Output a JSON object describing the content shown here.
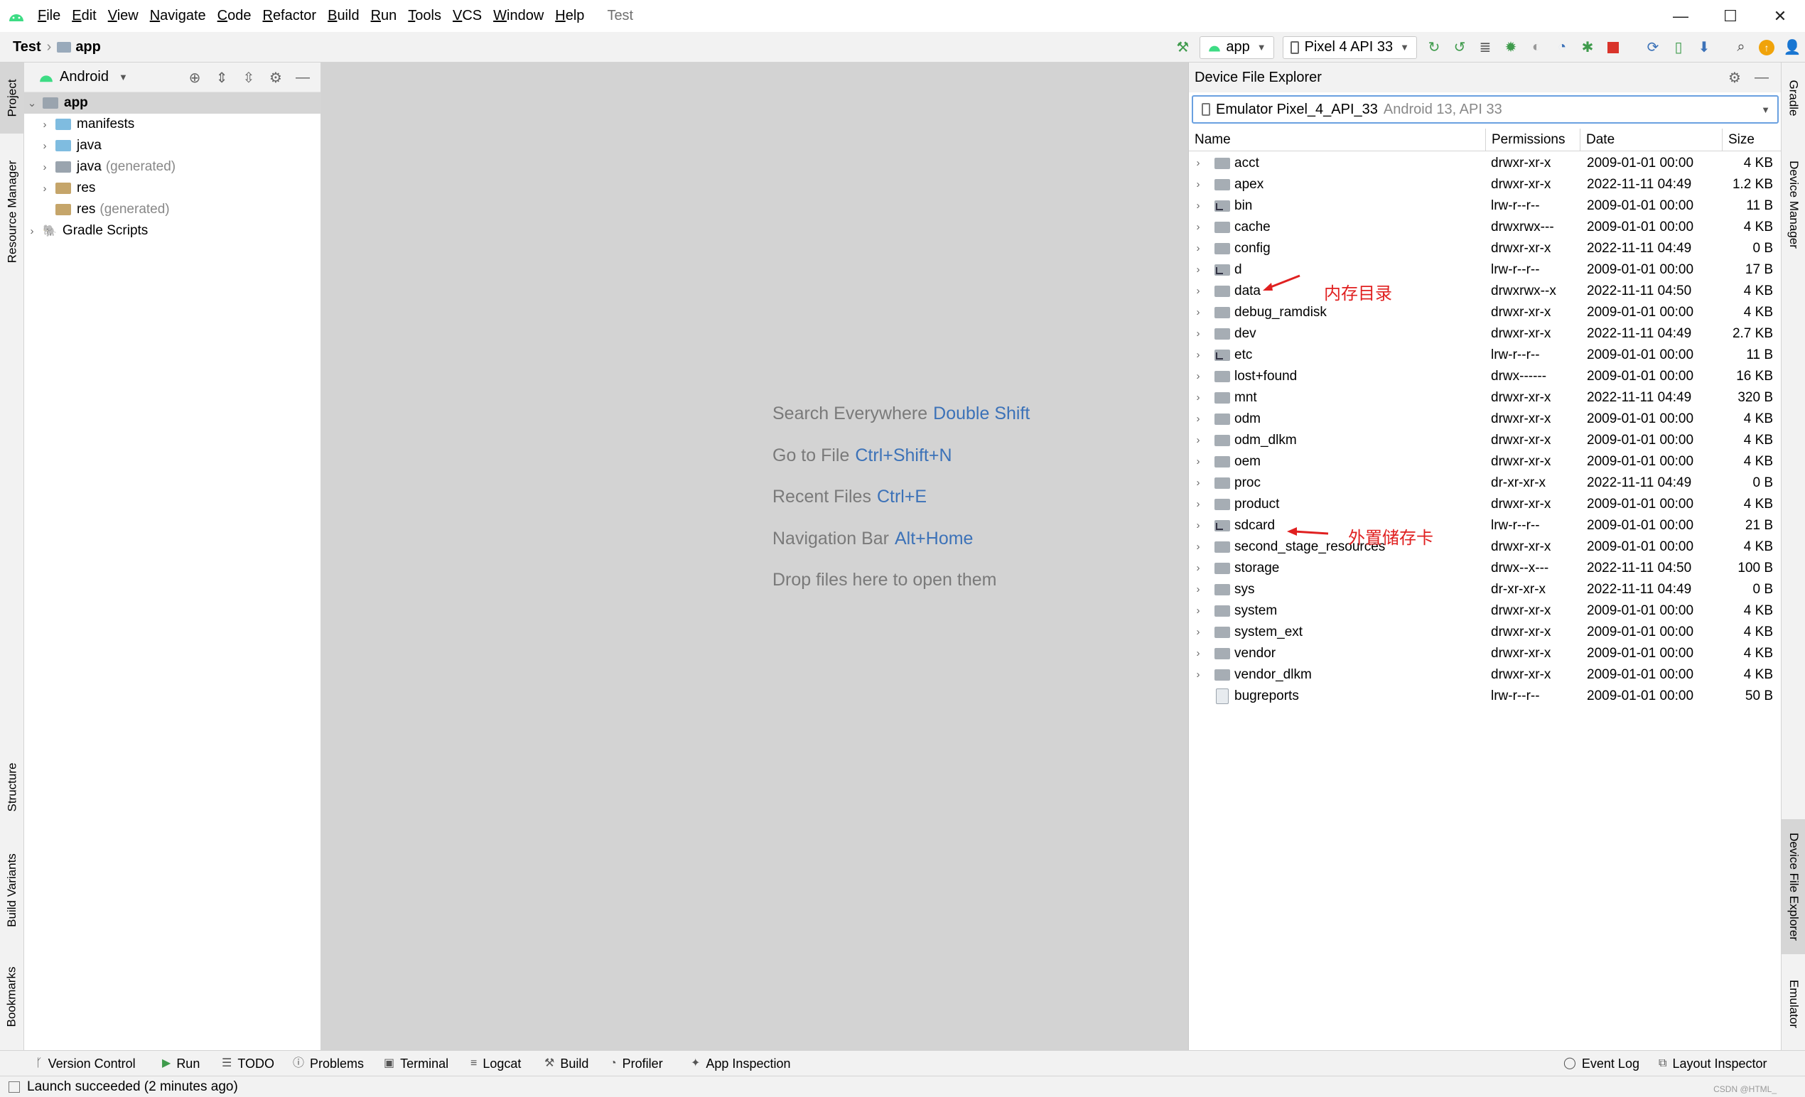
{
  "window": {
    "title": "Test",
    "menu": [
      {
        "u": "F",
        "rest": "ile"
      },
      {
        "u": "E",
        "rest": "dit"
      },
      {
        "u": "V",
        "rest": "iew"
      },
      {
        "u": "N",
        "rest": "avigate"
      },
      {
        "u": "C",
        "rest": "ode"
      },
      {
        "u": "R",
        "rest": "efactor"
      },
      {
        "u": "B",
        "rest": "uild"
      },
      {
        "u": "R",
        "rest": "un"
      },
      {
        "u": "T",
        "rest": "ools"
      },
      {
        "u": "V",
        "rest": "CS"
      },
      {
        "u": "W",
        "rest": "indow"
      },
      {
        "u": "H",
        "rest": "elp"
      }
    ],
    "controls": {
      "minimize": "—",
      "maximize": "☐",
      "close": "✕"
    }
  },
  "breadcrumb": {
    "project": "Test",
    "module": "app"
  },
  "toolbar": {
    "run_config": "app",
    "device": "Pixel 4 API 33"
  },
  "left_tabs": {
    "project": "Project",
    "resource_manager": "Resource Manager",
    "structure": "Structure",
    "build_variants": "Build Variants",
    "bookmarks": "Bookmarks"
  },
  "right_tabs": {
    "gradle": "Gradle",
    "device_manager": "Device Manager",
    "device_file_explorer": "Device File Explorer",
    "emulator": "Emulator"
  },
  "project_panel": {
    "view": "Android",
    "tree": [
      {
        "label": "app",
        "suffix": "",
        "depth": 0,
        "expanded": true,
        "selected": true,
        "icon": "module"
      },
      {
        "label": "manifests",
        "suffix": "",
        "depth": 1,
        "expanded": false,
        "icon": "folder"
      },
      {
        "label": "java",
        "suffix": "",
        "depth": 1,
        "expanded": false,
        "icon": "folder"
      },
      {
        "label": "java",
        "suffix": "(generated)",
        "depth": 1,
        "expanded": false,
        "icon": "gen"
      },
      {
        "label": "res",
        "suffix": "",
        "depth": 1,
        "expanded": false,
        "icon": "res"
      },
      {
        "label": "res",
        "suffix": "(generated)",
        "depth": 1,
        "expanded": null,
        "icon": "res"
      },
      {
        "label": "Gradle Scripts",
        "suffix": "",
        "depth": 0,
        "expanded": false,
        "icon": "gradle"
      }
    ]
  },
  "editor_hints": [
    {
      "text": "Search Everywhere",
      "key": "Double Shift"
    },
    {
      "text": "Go to File",
      "key": "Ctrl+Shift+N"
    },
    {
      "text": "Recent Files",
      "key": "Ctrl+E"
    },
    {
      "text": "Navigation Bar",
      "key": "Alt+Home"
    },
    {
      "text": "Drop files here to open them",
      "key": ""
    }
  ],
  "device_file_explorer": {
    "title": "Device File Explorer",
    "device": "Emulator Pixel_4_API_33",
    "device_meta": "Android 13, API 33",
    "columns": [
      "Name",
      "Permissions",
      "Date",
      "Size"
    ],
    "rows": [
      {
        "name": "acct",
        "perm": "drwxr-xr-x",
        "date": "2009-01-01 00:00",
        "size": "4 KB",
        "type": "dir"
      },
      {
        "name": "apex",
        "perm": "drwxr-xr-x",
        "date": "2022-11-11 04:49",
        "size": "1.2 KB",
        "type": "dir"
      },
      {
        "name": "bin",
        "perm": "lrw-r--r--",
        "date": "2009-01-01 00:00",
        "size": "11 B",
        "type": "link"
      },
      {
        "name": "cache",
        "perm": "drwxrwx---",
        "date": "2009-01-01 00:00",
        "size": "4 KB",
        "type": "dir"
      },
      {
        "name": "config",
        "perm": "drwxr-xr-x",
        "date": "2022-11-11 04:49",
        "size": "0 B",
        "type": "dir"
      },
      {
        "name": "d",
        "perm": "lrw-r--r--",
        "date": "2009-01-01 00:00",
        "size": "17 B",
        "type": "link"
      },
      {
        "name": "data",
        "perm": "drwxrwx--x",
        "date": "2022-11-11 04:50",
        "size": "4 KB",
        "type": "dir"
      },
      {
        "name": "debug_ramdisk",
        "perm": "drwxr-xr-x",
        "date": "2009-01-01 00:00",
        "size": "4 KB",
        "type": "dir"
      },
      {
        "name": "dev",
        "perm": "drwxr-xr-x",
        "date": "2022-11-11 04:49",
        "size": "2.7 KB",
        "type": "dir"
      },
      {
        "name": "etc",
        "perm": "lrw-r--r--",
        "date": "2009-01-01 00:00",
        "size": "11 B",
        "type": "link"
      },
      {
        "name": "lost+found",
        "perm": "drwx------",
        "date": "2009-01-01 00:00",
        "size": "16 KB",
        "type": "dir"
      },
      {
        "name": "mnt",
        "perm": "drwxr-xr-x",
        "date": "2022-11-11 04:49",
        "size": "320 B",
        "type": "dir"
      },
      {
        "name": "odm",
        "perm": "drwxr-xr-x",
        "date": "2009-01-01 00:00",
        "size": "4 KB",
        "type": "dir"
      },
      {
        "name": "odm_dlkm",
        "perm": "drwxr-xr-x",
        "date": "2009-01-01 00:00",
        "size": "4 KB",
        "type": "dir"
      },
      {
        "name": "oem",
        "perm": "drwxr-xr-x",
        "date": "2009-01-01 00:00",
        "size": "4 KB",
        "type": "dir"
      },
      {
        "name": "proc",
        "perm": "dr-xr-xr-x",
        "date": "2022-11-11 04:49",
        "size": "0 B",
        "type": "dir"
      },
      {
        "name": "product",
        "perm": "drwxr-xr-x",
        "date": "2009-01-01 00:00",
        "size": "4 KB",
        "type": "dir"
      },
      {
        "name": "sdcard",
        "perm": "lrw-r--r--",
        "date": "2009-01-01 00:00",
        "size": "21 B",
        "type": "link"
      },
      {
        "name": "second_stage_resources",
        "perm": "drwxr-xr-x",
        "date": "2009-01-01 00:00",
        "size": "4 KB",
        "type": "dir"
      },
      {
        "name": "storage",
        "perm": "drwx--x---",
        "date": "2022-11-11 04:50",
        "size": "100 B",
        "type": "dir"
      },
      {
        "name": "sys",
        "perm": "dr-xr-xr-x",
        "date": "2022-11-11 04:49",
        "size": "0 B",
        "type": "dir"
      },
      {
        "name": "system",
        "perm": "drwxr-xr-x",
        "date": "2009-01-01 00:00",
        "size": "4 KB",
        "type": "dir"
      },
      {
        "name": "system_ext",
        "perm": "drwxr-xr-x",
        "date": "2009-01-01 00:00",
        "size": "4 KB",
        "type": "dir"
      },
      {
        "name": "vendor",
        "perm": "drwxr-xr-x",
        "date": "2009-01-01 00:00",
        "size": "4 KB",
        "type": "dir"
      },
      {
        "name": "vendor_dlkm",
        "perm": "drwxr-xr-x",
        "date": "2009-01-01 00:00",
        "size": "4 KB",
        "type": "dir"
      },
      {
        "name": "bugreports",
        "perm": "lrw-r--r--",
        "date": "2009-01-01 00:00",
        "size": "50 B",
        "type": "file"
      }
    ],
    "annotations": {
      "data": "内存目录",
      "sdcard": "外置储存卡"
    }
  },
  "bottom_tools": {
    "version_control": "Version Control",
    "run": "Run",
    "todo": "TODO",
    "problems": "Problems",
    "terminal": "Terminal",
    "logcat": "Logcat",
    "build": "Build",
    "profiler": "Profiler",
    "app_inspection": "App Inspection",
    "event_log": "Event Log",
    "layout_inspector": "Layout Inspector"
  },
  "status": {
    "message": "Launch succeeded (2 minutes ago)"
  },
  "watermark": "CSDN @HTML_",
  "colors": {
    "accent": "#3c72b8",
    "annotation": "#e02020",
    "android_green": "#3ddc84"
  }
}
